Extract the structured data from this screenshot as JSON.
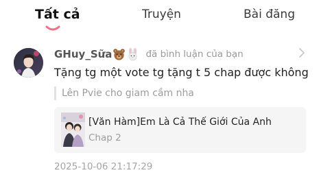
{
  "tabs": {
    "all": "Tất cả",
    "stories": "Truyện",
    "posts": "Bài đăng",
    "active_tab": "all",
    "indicator_color": "#f27089"
  },
  "notification": {
    "avatar_icon": "user-avatar-photo",
    "username": "GHuy_Sữa",
    "username_emojis": [
      "bear-face-emoji",
      "rabbit-face-emoji"
    ],
    "action": "đã bình luận của bạn",
    "comment": "Tặng tg một vote tg tặng t 5 chap được không",
    "quoted_reply": "Lên Pvie cho giam cầm nha",
    "story": {
      "cover_icon": "story-cover-image",
      "title": "[Văn Hàm]Em Là Cả Thế Giới Của Anh",
      "chapter": "Chap 2"
    },
    "timestamp": "2025-10-06 21:17:29"
  }
}
